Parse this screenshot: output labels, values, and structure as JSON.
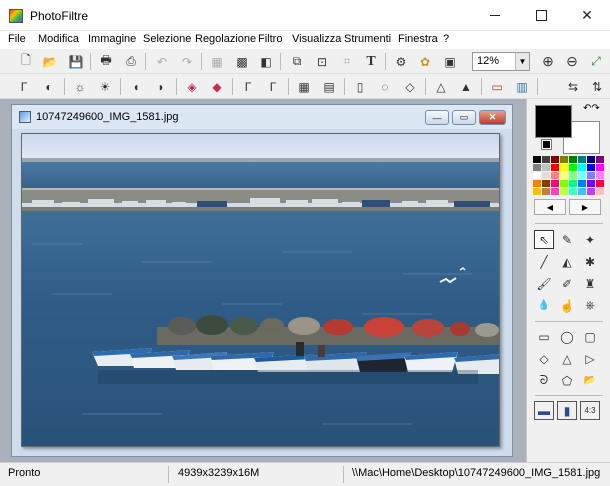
{
  "window": {
    "title": "PhotoFiltre",
    "minimize": "",
    "maximize": "",
    "close": "✕"
  },
  "menu": [
    "File",
    "Modifica",
    "Immagine",
    "Selezione",
    "Regolazione",
    "Filtro",
    "Visualizza",
    "Strumenti",
    "Finestra",
    "?"
  ],
  "toolbar1": {
    "tools": [
      {
        "name": "new-file-icon",
        "glyph": "🗋"
      },
      {
        "name": "open-folder-icon",
        "glyph": "📂"
      },
      {
        "name": "save-icon",
        "glyph": "💾"
      },
      {
        "name": "print-icon",
        "glyph": "🖶"
      },
      {
        "name": "scan-icon",
        "glyph": "⎙"
      },
      {
        "name": "undo-icon",
        "glyph": "↶"
      },
      {
        "name": "redo-icon",
        "glyph": "↷"
      },
      {
        "name": "grayscale-icon",
        "glyph": "▦"
      },
      {
        "name": "colors-icon",
        "glyph": "▩"
      },
      {
        "name": "transparency-icon",
        "glyph": "◧"
      },
      {
        "name": "image-size-icon",
        "glyph": "⧉"
      },
      {
        "name": "canvas-size-icon",
        "glyph": "⊡"
      },
      {
        "name": "crop-icon",
        "glyph": "⌗"
      },
      {
        "name": "text-icon",
        "glyph": "T"
      },
      {
        "name": "batch-icon",
        "glyph": "⚙"
      },
      {
        "name": "plugin-icon",
        "glyph": "✿"
      },
      {
        "name": "fullscreen-icon",
        "glyph": "▣"
      }
    ],
    "zoom_value": "12%",
    "zoom_arrow": "▼",
    "zoom_in": "⊕",
    "zoom_out": "⊖",
    "fit_window": "⤢"
  },
  "toolbar2": {
    "tools": [
      {
        "name": "auto-levels-icon",
        "glyph": "Γ"
      },
      {
        "name": "auto-contrast-icon",
        "glyph": "◐"
      },
      {
        "name": "brightness-minus-icon",
        "glyph": "☼"
      },
      {
        "name": "brightness-plus-icon",
        "glyph": "☀"
      },
      {
        "name": "contrast-minus-icon",
        "glyph": "◖"
      },
      {
        "name": "contrast-plus-icon",
        "glyph": "◗"
      },
      {
        "name": "saturation-minus-icon",
        "glyph": "◈"
      },
      {
        "name": "saturation-plus-icon",
        "glyph": "◆"
      },
      {
        "name": "gamma-minus-icon",
        "glyph": "Γ"
      },
      {
        "name": "gamma-plus-icon",
        "glyph": "Γ"
      },
      {
        "name": "mosaic-icon",
        "glyph": "▦"
      },
      {
        "name": "emboss-icon",
        "glyph": "▤"
      },
      {
        "name": "blur-icon",
        "glyph": "▯"
      },
      {
        "name": "soften-icon",
        "glyph": "◌"
      },
      {
        "name": "sharpen-icon",
        "glyph": "◇"
      },
      {
        "name": "sharpen-more-icon",
        "glyph": "△"
      },
      {
        "name": "filter-triangle-icon",
        "glyph": "▲"
      },
      {
        "name": "gradient-icon",
        "glyph": "▭"
      },
      {
        "name": "texture-icon",
        "glyph": "▥"
      },
      {
        "name": "flip-horizontal-icon",
        "glyph": "⇆"
      },
      {
        "name": "flip-vertical-icon",
        "glyph": "⇅"
      }
    ]
  },
  "document": {
    "title": "10747249600_IMG_1581.jpg",
    "minimize": "—",
    "maximize": "▭",
    "close": "✕"
  },
  "palette": {
    "colors": [
      "#000000",
      "#404040",
      "#800000",
      "#808000",
      "#008000",
      "#008080",
      "#000080",
      "#800080",
      "#808080",
      "#c0c0c0",
      "#ff0000",
      "#ffff00",
      "#00ff00",
      "#00ffff",
      "#0000ff",
      "#ff00ff",
      "#ffffff",
      "#e0e0e0",
      "#ff8080",
      "#ffff80",
      "#80ff80",
      "#80ffff",
      "#8080ff",
      "#ff80ff",
      "#ff8000",
      "#804000",
      "#ff0080",
      "#80ff00",
      "#00ff80",
      "#0080ff",
      "#8000ff",
      "#ff0040",
      "#ffc000",
      "#c08040",
      "#ff40c0",
      "#c0ff40",
      "#40ffc0",
      "#40c0ff",
      "#c040ff",
      "#ffc0c0"
    ],
    "left": "◀",
    "right": "▶",
    "swap": "↶↷"
  },
  "tools": [
    {
      "name": "selection-arrow-icon",
      "glyph": "⇖"
    },
    {
      "name": "eyedropper-icon",
      "glyph": "✎"
    },
    {
      "name": "magic-wand-icon",
      "glyph": "✦"
    },
    {
      "name": "line-icon",
      "glyph": "╱"
    },
    {
      "name": "fill-bucket-icon",
      "glyph": "◭"
    },
    {
      "name": "spray-icon",
      "glyph": "✱"
    },
    {
      "name": "brush-icon",
      "glyph": "🖌"
    },
    {
      "name": "advanced-brush-icon",
      "glyph": "✐"
    },
    {
      "name": "stamp-icon",
      "glyph": "♜"
    },
    {
      "name": "blur-drop-icon",
      "glyph": "💧"
    },
    {
      "name": "smudge-icon",
      "glyph": "☝"
    },
    {
      "name": "clone-icon",
      "glyph": "⎈"
    },
    {
      "name": "rect-select-icon",
      "glyph": "▭"
    },
    {
      "name": "ellipse-select-icon",
      "glyph": "◯"
    },
    {
      "name": "rounded-rect-select-icon",
      "glyph": "▢"
    },
    {
      "name": "diamond-select-icon",
      "glyph": "◇"
    },
    {
      "name": "triangle-select-icon",
      "glyph": "△"
    },
    {
      "name": "play-select-icon",
      "glyph": "▷"
    },
    {
      "name": "lasso-icon",
      "glyph": "ᘐ"
    },
    {
      "name": "polygon-icon",
      "glyph": "⬠"
    },
    {
      "name": "open-selection-icon",
      "glyph": "📂"
    },
    {
      "name": "selection-horizontal-icon",
      "glyph": "▬"
    },
    {
      "name": "selection-vertical-icon",
      "glyph": "▮"
    },
    {
      "name": "aspect-ratio-label",
      "glyph": "4:3"
    }
  ],
  "status": {
    "state": "Pronto",
    "dimensions": "4939x3239x16M",
    "path": "\\\\Mac\\Home\\Desktop\\10747249600_IMG_1581.jpg"
  }
}
